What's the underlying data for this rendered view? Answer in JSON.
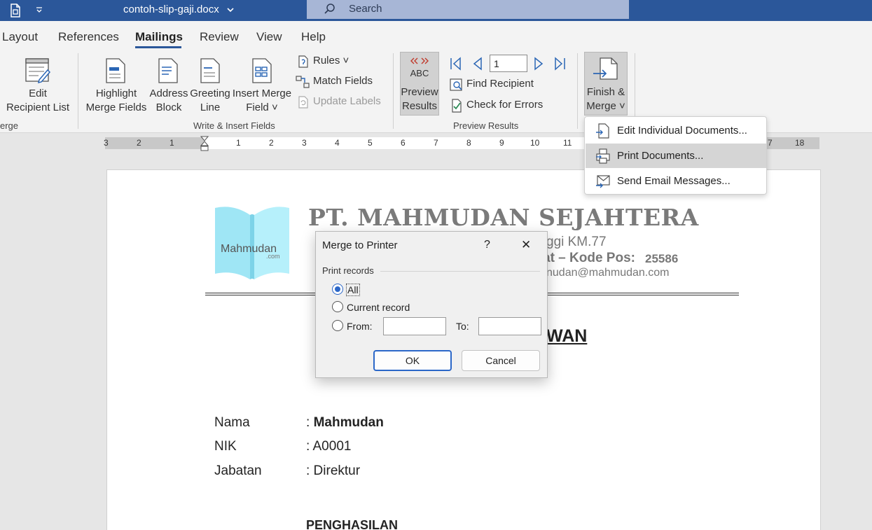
{
  "titlebar": {
    "filename": "contoh-slip-gaji.docx",
    "search_placeholder": "Search"
  },
  "tabs": [
    {
      "label": "Layout"
    },
    {
      "label": "References"
    },
    {
      "label": "Mailings"
    },
    {
      "label": "Review"
    },
    {
      "label": "View"
    },
    {
      "label": "Help"
    }
  ],
  "ribbon": {
    "edit_recipient_line1": "Edit",
    "edit_recipient_line2": "Recipient List",
    "group_start_label": "erge",
    "highlight_line1": "Highlight",
    "highlight_line2": "Merge Fields",
    "address_line1": "Address",
    "address_line2": "Block",
    "greeting_line1": "Greeting",
    "greeting_line2": "Line",
    "insert_merge_line1": "Insert Merge",
    "insert_merge_line2": "Field ˅",
    "rules": "Rules ˅",
    "match_fields": "Match Fields",
    "update_labels": "Update Labels",
    "group_write_label": "Write & Insert Fields",
    "preview_abc": "ABC",
    "preview_line1": "Preview",
    "preview_line2": "Results",
    "record_number": "1",
    "find_recipient": "Find Recipient",
    "check_errors": "Check for Errors",
    "group_preview_label": "Preview Results",
    "finish_line1": "Finish &",
    "finish_line2": "Merge ˅"
  },
  "ruler": {
    "left_numbers": [
      "3",
      "2",
      "1"
    ],
    "right_numbers": [
      "1",
      "2",
      "3",
      "4",
      "5",
      "6",
      "7",
      "8",
      "9",
      "10",
      "11"
    ],
    "far_right_numbers": [
      "7",
      "18"
    ]
  },
  "document": {
    "logo_text": "Mahmudan",
    "logo_subtext": ".com",
    "company_name": "PT. MAHMUDAN SEJAHTERA",
    "address_line": "ggi KM.77",
    "postal_line_bold": "at – Kode Pos:",
    "postal_code": "25586",
    "email_line": "nudan@mahmudan.com",
    "title_partial": "WAN",
    "rows": [
      {
        "label": "Nama",
        "value": ": ",
        "value_bold": "Mahmudan"
      },
      {
        "label": "NIK",
        "value": ": A0001",
        "value_bold": ""
      },
      {
        "label": "Jabatan",
        "value": ": Direktur",
        "value_bold": ""
      }
    ],
    "section_heading": "PENGHASILAN"
  },
  "finish_menu": {
    "items": [
      {
        "label": "Edit Individual Documents..."
      },
      {
        "label": "Print Documents..."
      },
      {
        "label": "Send Email Messages..."
      }
    ]
  },
  "dialog": {
    "title": "Merge to Printer",
    "help": "?",
    "close": "✕",
    "section_label": "Print records",
    "opt_all": "All",
    "opt_current": "Current record",
    "opt_from": "From:",
    "opt_to": "To:",
    "from_value": "",
    "to_value": "",
    "ok_label": "OK",
    "cancel_label": "Cancel"
  },
  "colors": {
    "titlebar": "#2b579a",
    "accent": "#2b67c8",
    "icon_blue": "#2b66b5"
  }
}
